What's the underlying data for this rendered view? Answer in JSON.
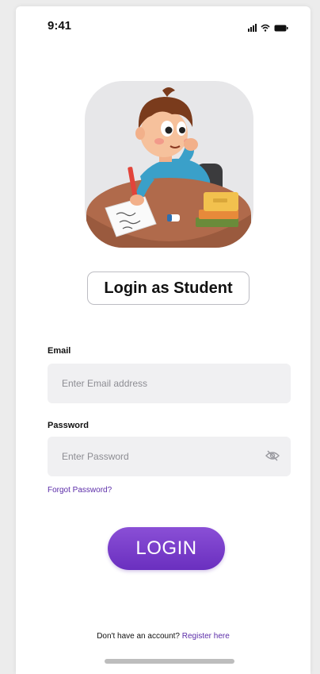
{
  "status_bar": {
    "time": "9:41",
    "icons": [
      "signal-icon",
      "wifi-icon",
      "battery-icon"
    ]
  },
  "illustration": {
    "icon": "student-writing-illustration"
  },
  "role_chip": {
    "label": "Login as Student"
  },
  "form": {
    "email_label": "Email",
    "email_placeholder": "Enter Email address",
    "email_value": "",
    "password_label": "Password",
    "password_placeholder": "Enter Password",
    "password_value": "",
    "forgot_link": "Forgot Password?",
    "login_button": "LOGIN"
  },
  "footer": {
    "prompt": "Don't have an account?",
    "register_link": "Register here"
  },
  "colors": {
    "accent": "#6a2fbf",
    "link": "#5b2ca8",
    "field_bg": "#f0f0f2"
  }
}
